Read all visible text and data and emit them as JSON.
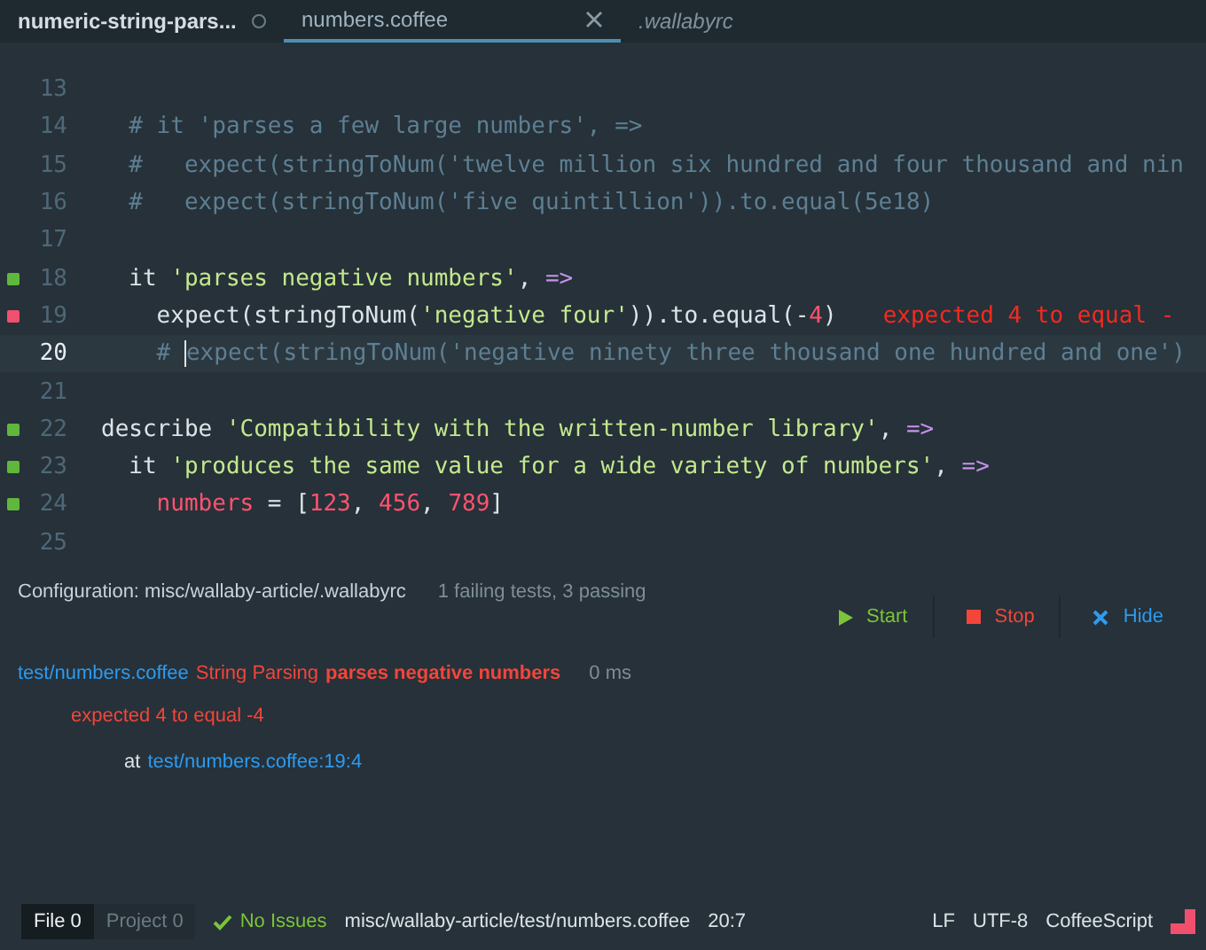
{
  "tabs": [
    {
      "label": "numeric-string-pars...",
      "selected": false,
      "modified": true,
      "italic": false
    },
    {
      "label": "numbers.coffee",
      "selected": true,
      "modified": false,
      "italic": false
    },
    {
      "label": ".wallabyrc",
      "selected": false,
      "modified": false,
      "italic": true
    }
  ],
  "editor": {
    "lines": [
      {
        "number": "13",
        "current": false
      },
      {
        "number": "14",
        "current": false,
        "tokens": [
          {
            "text": "  # it 'parses a few large numbers', =>",
            "kind": "comment"
          }
        ]
      },
      {
        "number": "15",
        "current": false,
        "tokens": [
          {
            "text": "  #   expect(stringToNum('twelve million six hundred and four thousand and nin",
            "kind": "comment"
          }
        ]
      },
      {
        "number": "16",
        "current": false,
        "tokens": [
          {
            "text": "  #   expect(stringToNum('five quintillion')).to.equal(5e18)",
            "kind": "comment"
          }
        ]
      },
      {
        "number": "17",
        "current": false
      },
      {
        "number": "18",
        "passed": true,
        "current": false,
        "tokens": [
          {
            "text": "  it ",
            "kind": "plain"
          },
          {
            "text": "'parses negative numbers'",
            "kind": "string"
          },
          {
            "text": ", ",
            "kind": "plain"
          },
          {
            "text": "=>",
            "kind": "keyword"
          }
        ]
      },
      {
        "number": "19",
        "passed": false,
        "current": false,
        "tokens": [
          {
            "text": "    expect(stringToNum(",
            "kind": "plain"
          },
          {
            "text": "'negative four'",
            "kind": "string"
          },
          {
            "text": ")).to.equal(-",
            "kind": "plain"
          },
          {
            "text": "4",
            "kind": "number"
          },
          {
            "text": ")",
            "kind": "plain"
          },
          {
            "text": "expected 4 to equal -",
            "kind": "error"
          }
        ]
      },
      {
        "number": "20",
        "current": true,
        "tokens": [
          {
            "text": "    # ",
            "kind": "comment"
          },
          {
            "text": "expect(stringToNum('negative ninety three thousand one hundred and one')",
            "kind": "comment",
            "caret_before": true
          }
        ]
      },
      {
        "number": "21",
        "current": false
      },
      {
        "number": "22",
        "passed": true,
        "current": false,
        "tokens": [
          {
            "text": "describe ",
            "kind": "plain"
          },
          {
            "text": "'Compatibility with the written-number library'",
            "kind": "string"
          },
          {
            "text": ", ",
            "kind": "plain"
          },
          {
            "text": "=>",
            "kind": "keyword"
          }
        ]
      },
      {
        "number": "23",
        "passed": true,
        "current": false,
        "tokens": [
          {
            "text": "  it ",
            "kind": "plain"
          },
          {
            "text": "'produces the same value for a wide variety of numbers'",
            "kind": "string"
          },
          {
            "text": ", ",
            "kind": "plain"
          },
          {
            "text": "=>",
            "kind": "keyword"
          }
        ]
      },
      {
        "number": "24",
        "passed": true,
        "current": false,
        "tokens": [
          {
            "text": "    numbers",
            "kind": "variable"
          },
          {
            "text": " = [",
            "kind": "plain"
          },
          {
            "text": "123",
            "kind": "number"
          },
          {
            "text": ", ",
            "kind": "plain"
          },
          {
            "text": "456",
            "kind": "number"
          },
          {
            "text": ", ",
            "kind": "plain"
          },
          {
            "text": "789",
            "kind": "number"
          },
          {
            "text": "]",
            "kind": "plain"
          }
        ]
      },
      {
        "number": "25",
        "current": false
      }
    ]
  },
  "wallaby": {
    "configuration": "Configuration: misc/wallaby-article/.wallabyrc",
    "summary": "1 failing tests, 3 passing",
    "buttons": [
      {
        "label": "Start",
        "kind": "start"
      },
      {
        "label": "Stop",
        "kind": "stop"
      },
      {
        "label": "Hide",
        "kind": "hide"
      }
    ],
    "result": {
      "file": "test/numbers.coffee",
      "suite": "String Parsing",
      "test": "parses negative numbers",
      "time": "0 ms",
      "message": "expected 4 to equal -4",
      "at": "at",
      "location": "test/numbers.coffee:19:4"
    }
  },
  "status_bar": {
    "scopes": [
      {
        "label": "File",
        "count": "0",
        "selected": true
      },
      {
        "label": "Project",
        "count": "0",
        "selected": false
      }
    ],
    "issues": "No Issues",
    "path": "misc/wallaby-article/test/numbers.coffee",
    "cursor": "20:7",
    "line_ending": "LF",
    "encoding": "UTF-8",
    "grammar": "CoffeeScript"
  }
}
